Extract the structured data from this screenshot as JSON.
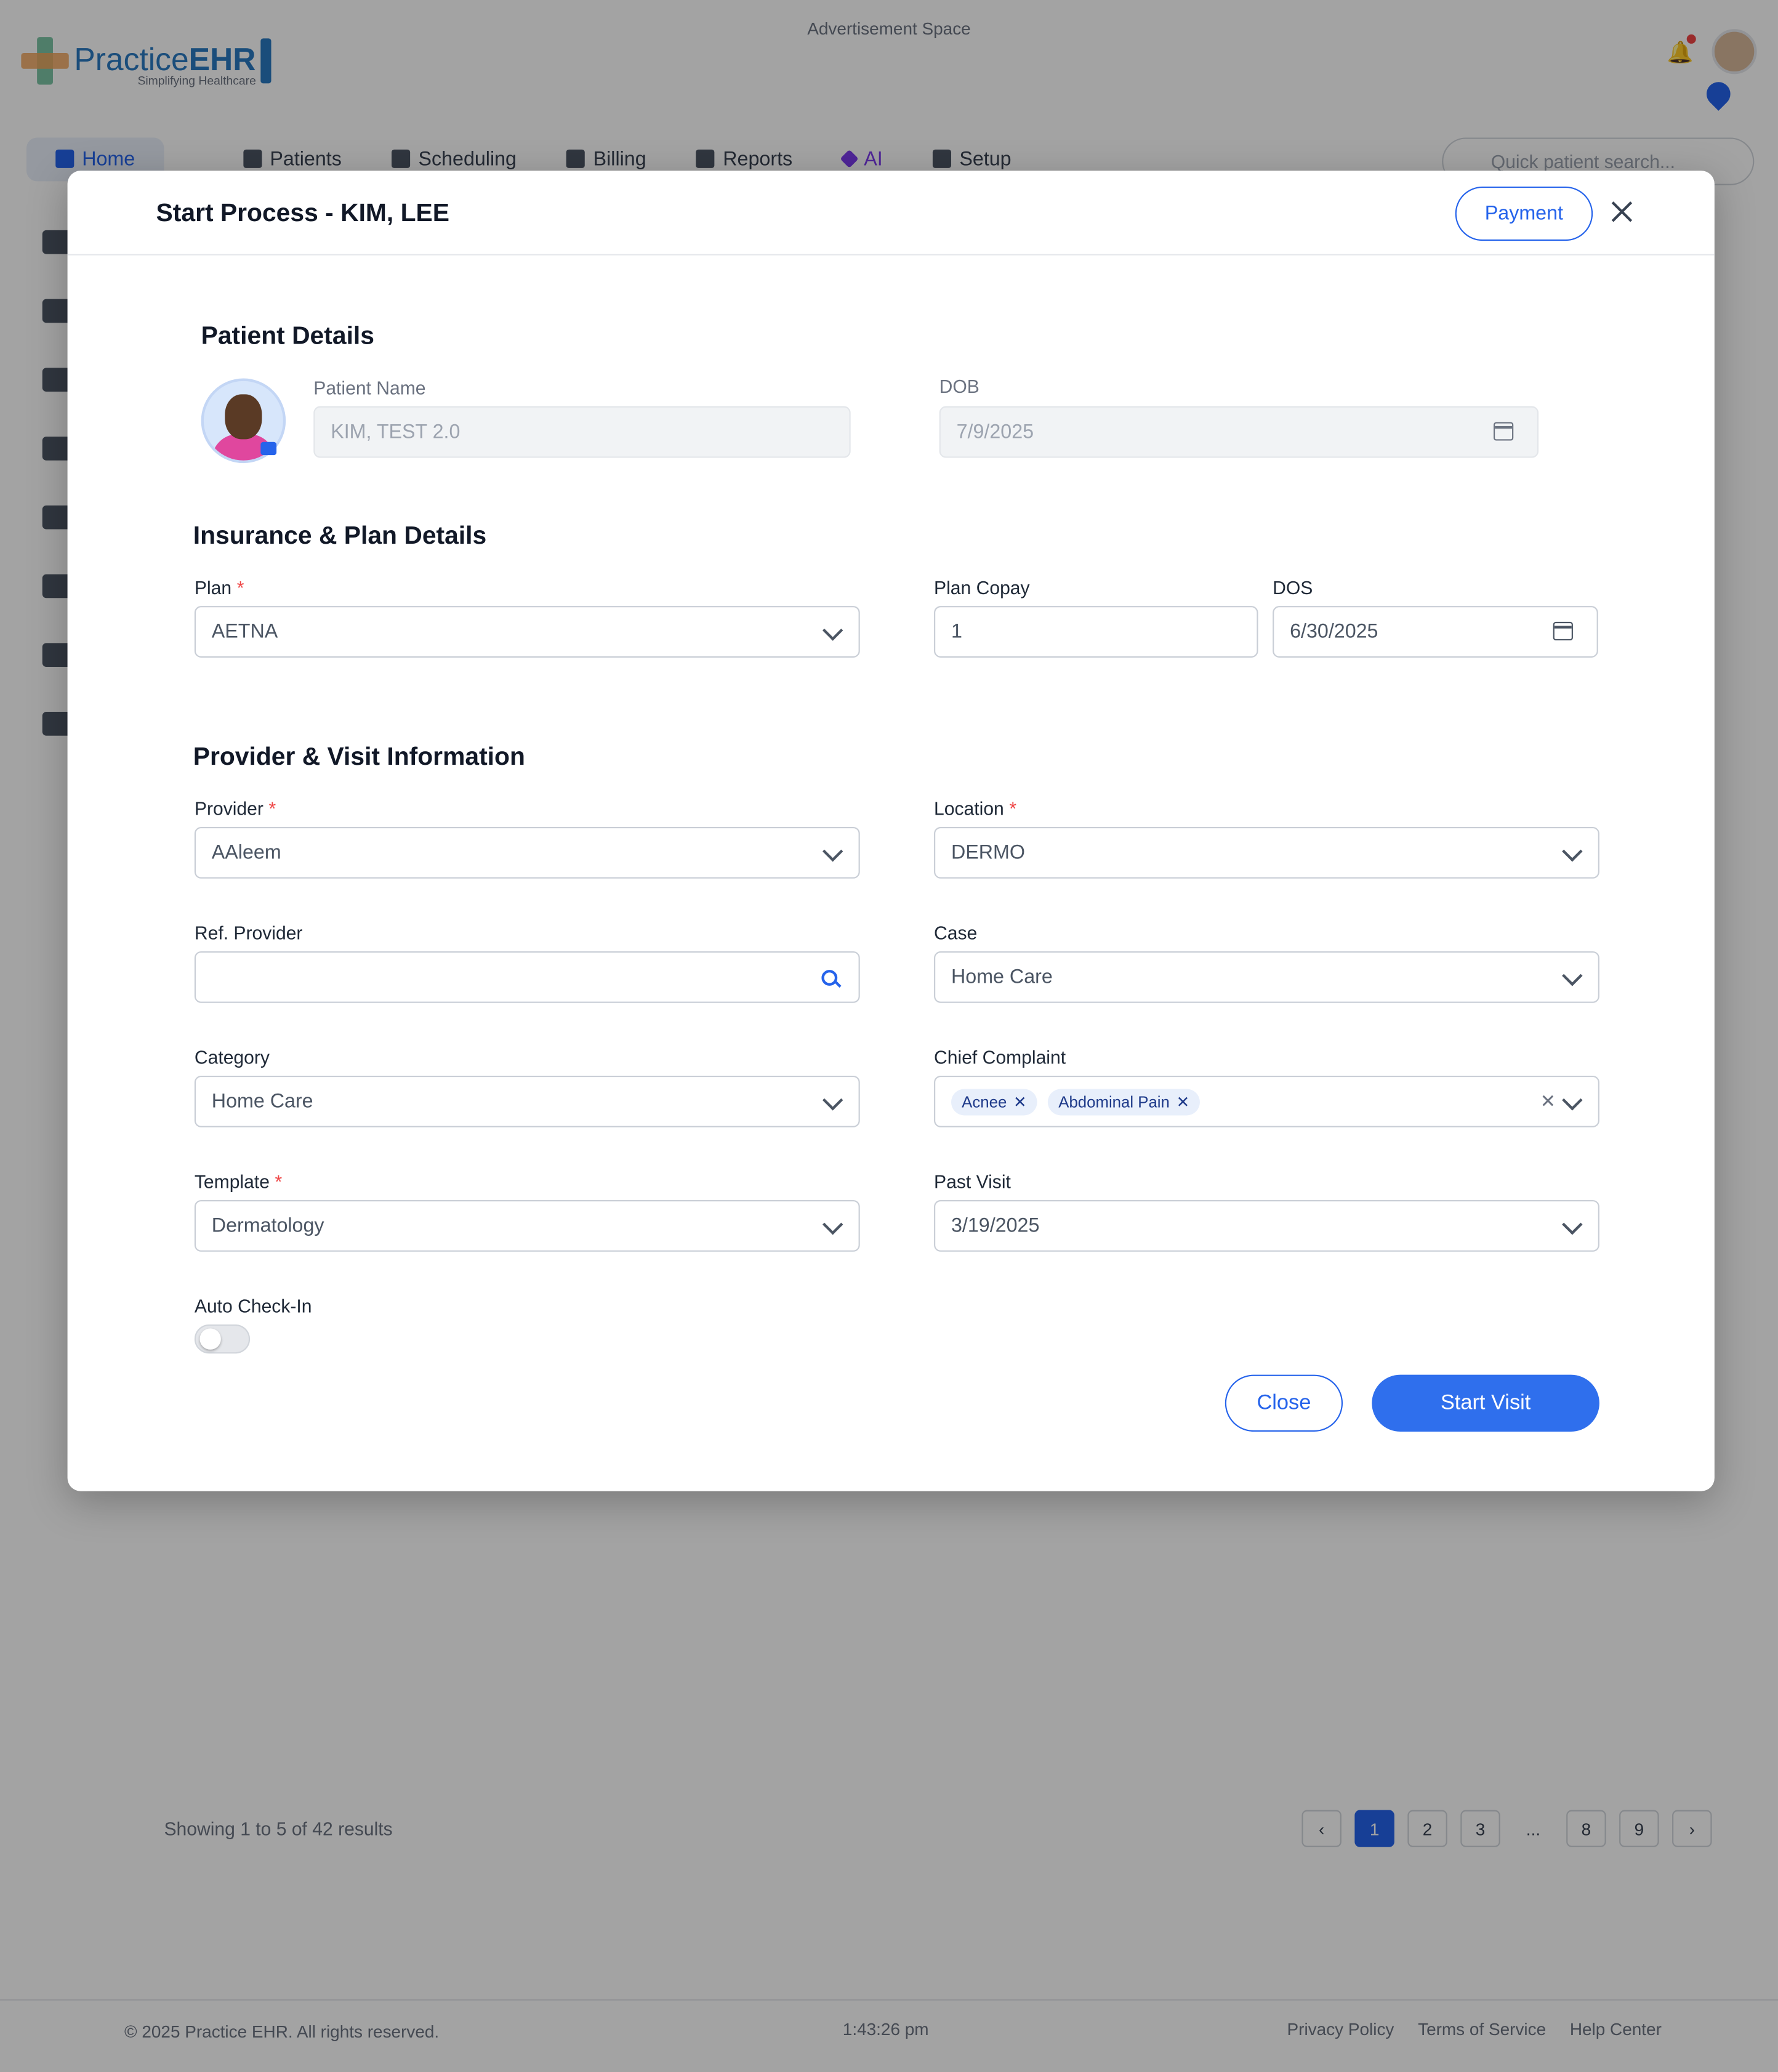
{
  "background": {
    "advertisement": "Advertisement Space",
    "logo": {
      "name_light": "Practice",
      "name_bold": "EHR",
      "tagline": "Simplifying Healthcare"
    },
    "nav": [
      {
        "label": "Home",
        "icon": "home-icon"
      },
      {
        "label": "Patients",
        "icon": "patients-icon"
      },
      {
        "label": "Scheduling",
        "icon": "calendar-icon"
      },
      {
        "label": "Billing",
        "icon": "billing-icon"
      },
      {
        "label": "Reports",
        "icon": "reports-icon"
      },
      {
        "label": "AI",
        "icon": "sparkle-icon"
      },
      {
        "label": "Setup",
        "icon": "gear-icon"
      }
    ],
    "search_placeholder": "Quick patient search...",
    "results_text": "Showing 1 to 5 of 42 results",
    "pagination": [
      "1",
      "2",
      "3",
      "...",
      "8",
      "9"
    ],
    "active_page": "1",
    "footer": {
      "copyright": "© 2025 Practice EHR. All rights reserved.",
      "time": "1:43:26 pm",
      "links": [
        "Privacy Policy",
        "Terms of Service",
        "Help Center"
      ]
    }
  },
  "modal": {
    "title": "Start Process - KIM, LEE",
    "payment_label": "Payment",
    "sections": {
      "patient": "Patient Details",
      "insurance": "Insurance & Plan Details",
      "provider": "Provider & Visit Information"
    },
    "patient": {
      "name_label": "Patient Name",
      "name_value": "KIM, TEST 2.0",
      "dob_label": "DOB",
      "dob_value": "7/9/2025"
    },
    "insurance": {
      "plan_label": "Plan",
      "plan_value": "AETNA",
      "copay_label": "Plan Copay",
      "copay_value": "1",
      "dos_label": "DOS",
      "dos_value": "6/30/2025"
    },
    "provider": {
      "provider_label": "Provider",
      "provider_value": "AAleem",
      "location_label": "Location",
      "location_value": "DERMO",
      "ref_label": "Ref. Provider",
      "ref_value": "",
      "case_label": "Case",
      "case_value": "Home Care",
      "category_label": "Category",
      "category_value": "Home Care",
      "complaint_label": "Chief Complaint",
      "complaints": [
        "Acnee",
        "Abdominal Pain"
      ],
      "template_label": "Template",
      "template_value": "Dermatology",
      "past_visit_label": "Past Visit",
      "past_visit_value": "3/19/2025",
      "auto_checkin_label": "Auto Check-In",
      "auto_checkin_on": false
    },
    "buttons": {
      "close": "Close",
      "start": "Start Visit"
    },
    "required_mark": "*"
  },
  "colors": {
    "primary": "#2563eb",
    "required": "#ef4444",
    "overlay": "rgba(0,0,0,0.36)"
  }
}
